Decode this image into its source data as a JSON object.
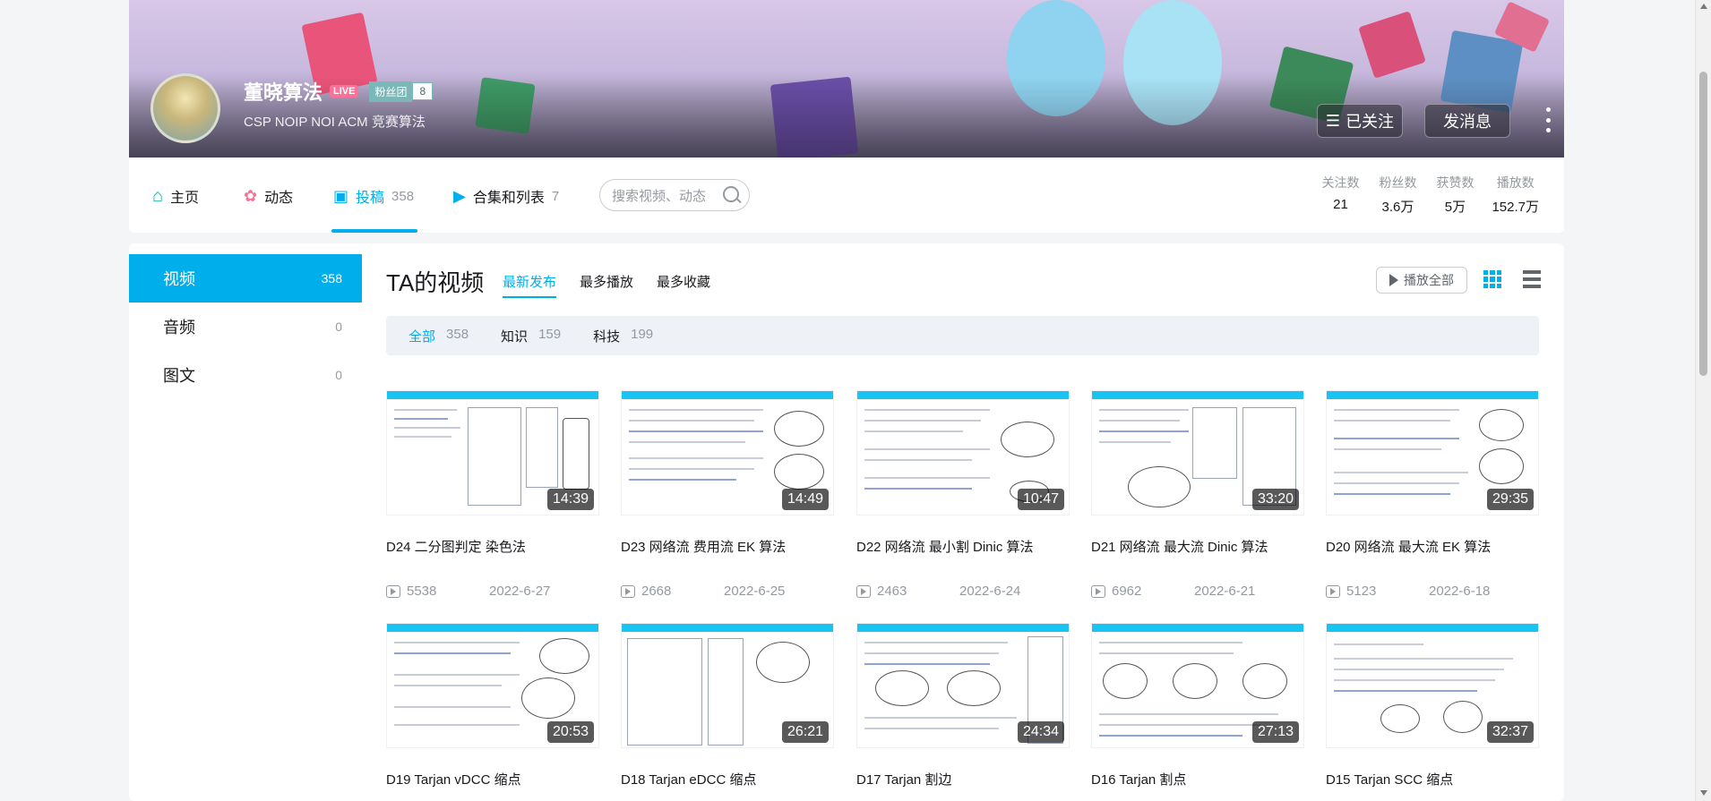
{
  "header": {
    "username": "董晓算法",
    "live_badge": "LIVE",
    "fans_badge_label": "粉丝团",
    "fans_badge_level": "8",
    "signature": "CSP NOIP NOI ACM 竞赛算法",
    "follow_button": "已关注",
    "message_button": "发消息"
  },
  "nav": {
    "home": "主页",
    "dynamic": "动态",
    "posts": "投稿",
    "posts_count": "358",
    "collections": "合集和列表",
    "collections_count": "7",
    "search_placeholder": "搜索视频、动态"
  },
  "stats": [
    {
      "label": "关注数",
      "value": "21"
    },
    {
      "label": "粉丝数",
      "value": "3.6万"
    },
    {
      "label": "获赞数",
      "value": "5万"
    },
    {
      "label": "播放数",
      "value": "152.7万"
    }
  ],
  "sidebar": {
    "items": [
      {
        "label": "视频",
        "count": "358"
      },
      {
        "label": "音频",
        "count": "0"
      },
      {
        "label": "图文",
        "count": "0"
      }
    ]
  },
  "main": {
    "title": "TA的视频",
    "sort_tabs": [
      "最新发布",
      "最多播放",
      "最多收藏"
    ],
    "play_all": "播放全部",
    "filters": [
      {
        "label": "全部",
        "count": "358"
      },
      {
        "label": "知识",
        "count": "159"
      },
      {
        "label": "科技",
        "count": "199"
      }
    ]
  },
  "videos": [
    {
      "title": "D24 二分图判定 染色法",
      "duration": "14:39",
      "plays": "5538",
      "date": "2022-6-27"
    },
    {
      "title": "D23 网络流 费用流 EK 算法",
      "duration": "14:49",
      "plays": "2668",
      "date": "2022-6-25"
    },
    {
      "title": "D22 网络流 最小割 Dinic 算法",
      "duration": "10:47",
      "plays": "2463",
      "date": "2022-6-24"
    },
    {
      "title": "D21 网络流 最大流 Dinic 算法",
      "duration": "33:20",
      "plays": "6962",
      "date": "2022-6-21"
    },
    {
      "title": "D20 网络流 最大流 EK 算法",
      "duration": "29:35",
      "plays": "5123",
      "date": "2022-6-18"
    },
    {
      "title": "D19 Tarjan vDCC 缩点",
      "duration": "20:53"
    },
    {
      "title": "D18 Tarjan eDCC 缩点",
      "duration": "26:21"
    },
    {
      "title": "D17 Tarjan 割边",
      "duration": "24:34"
    },
    {
      "title": "D16 Tarjan 割点",
      "duration": "27:13"
    },
    {
      "title": "D15 Tarjan SCC 缩点",
      "duration": "32:37"
    }
  ]
}
